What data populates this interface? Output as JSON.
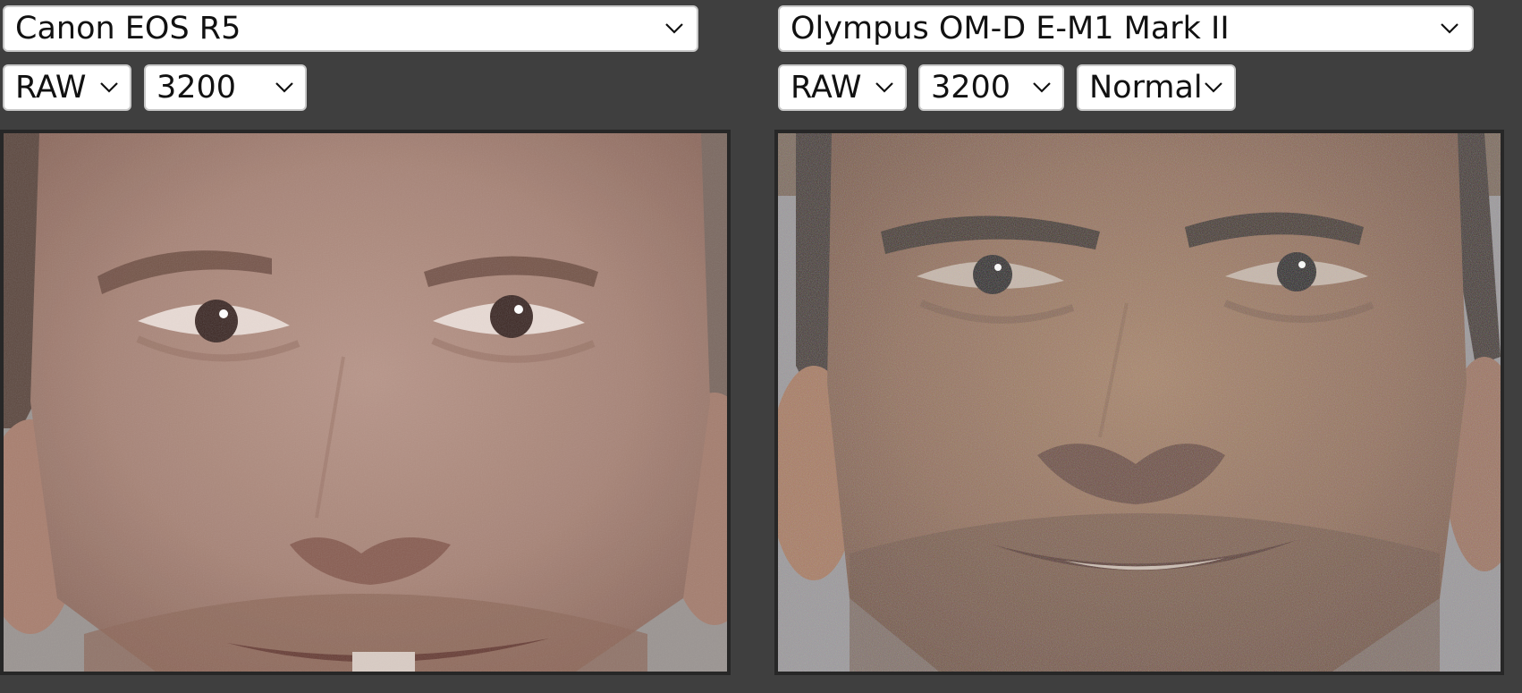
{
  "left_panel": {
    "camera": "Canon EOS R5",
    "format": "RAW",
    "iso": "3200",
    "image_alt": "Canon EOS R5 ISO 3200 face crop"
  },
  "right_panel": {
    "camera": "Olympus OM-D E-M1 Mark II",
    "format": "RAW",
    "iso": "3200",
    "mode": "Normal",
    "image_alt": "Olympus OM-D E-M1 Mark II ISO 3200 face crop"
  },
  "icons": {
    "dropdown": "chevron-down-icon"
  }
}
